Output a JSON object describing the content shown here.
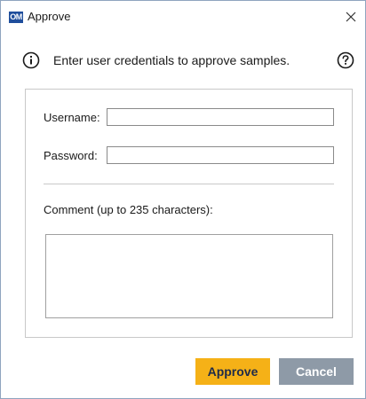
{
  "window": {
    "app_icon_label": "OM",
    "title": "Approve"
  },
  "info": {
    "message": "Enter user credentials to approve samples."
  },
  "form": {
    "username_label": "Username:",
    "username_value": "",
    "password_label": "Password:",
    "password_value": "",
    "comment_label": "Comment (up to 235 characters):",
    "comment_value": ""
  },
  "buttons": {
    "approve_label": "Approve",
    "cancel_label": "Cancel"
  },
  "colors": {
    "approve_bg": "#f5b117",
    "cancel_bg": "#8e9aa7",
    "app_icon_bg": "#1f4e9c"
  },
  "icons": {
    "close": "close-icon",
    "info": "info-icon",
    "help": "help-icon",
    "app": "app-icon"
  }
}
